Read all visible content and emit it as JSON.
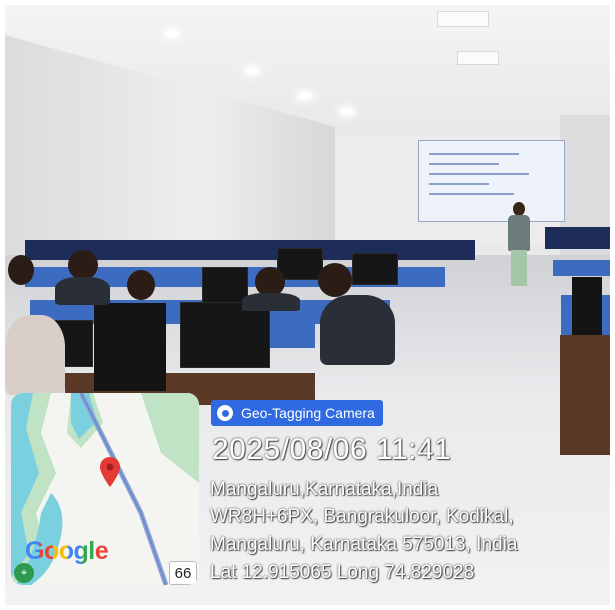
{
  "overlay": {
    "badge_label": "Geo-Tagging Camera",
    "datetime": "2025/08/06 11:41",
    "lines": [
      "Mangaluru,Karnataka,India",
      "WR8H+6PX, Bangrakuloor, Kodikal,",
      "Mangaluru, Karnataka 575013, India",
      "Lat 12.915065 Long 74.829028"
    ]
  },
  "map": {
    "brand": "Google",
    "route_number": "66",
    "pin_icon": "map-pin-icon",
    "brand_colors": [
      "#4285F4",
      "#EA4335",
      "#FBBC05",
      "#4285F4",
      "#34A853",
      "#EA4335"
    ]
  },
  "colors": {
    "badge": "#2f6ae0",
    "water": "#7bd0df",
    "park": "#bfe3c4",
    "pin": "#e53935"
  }
}
